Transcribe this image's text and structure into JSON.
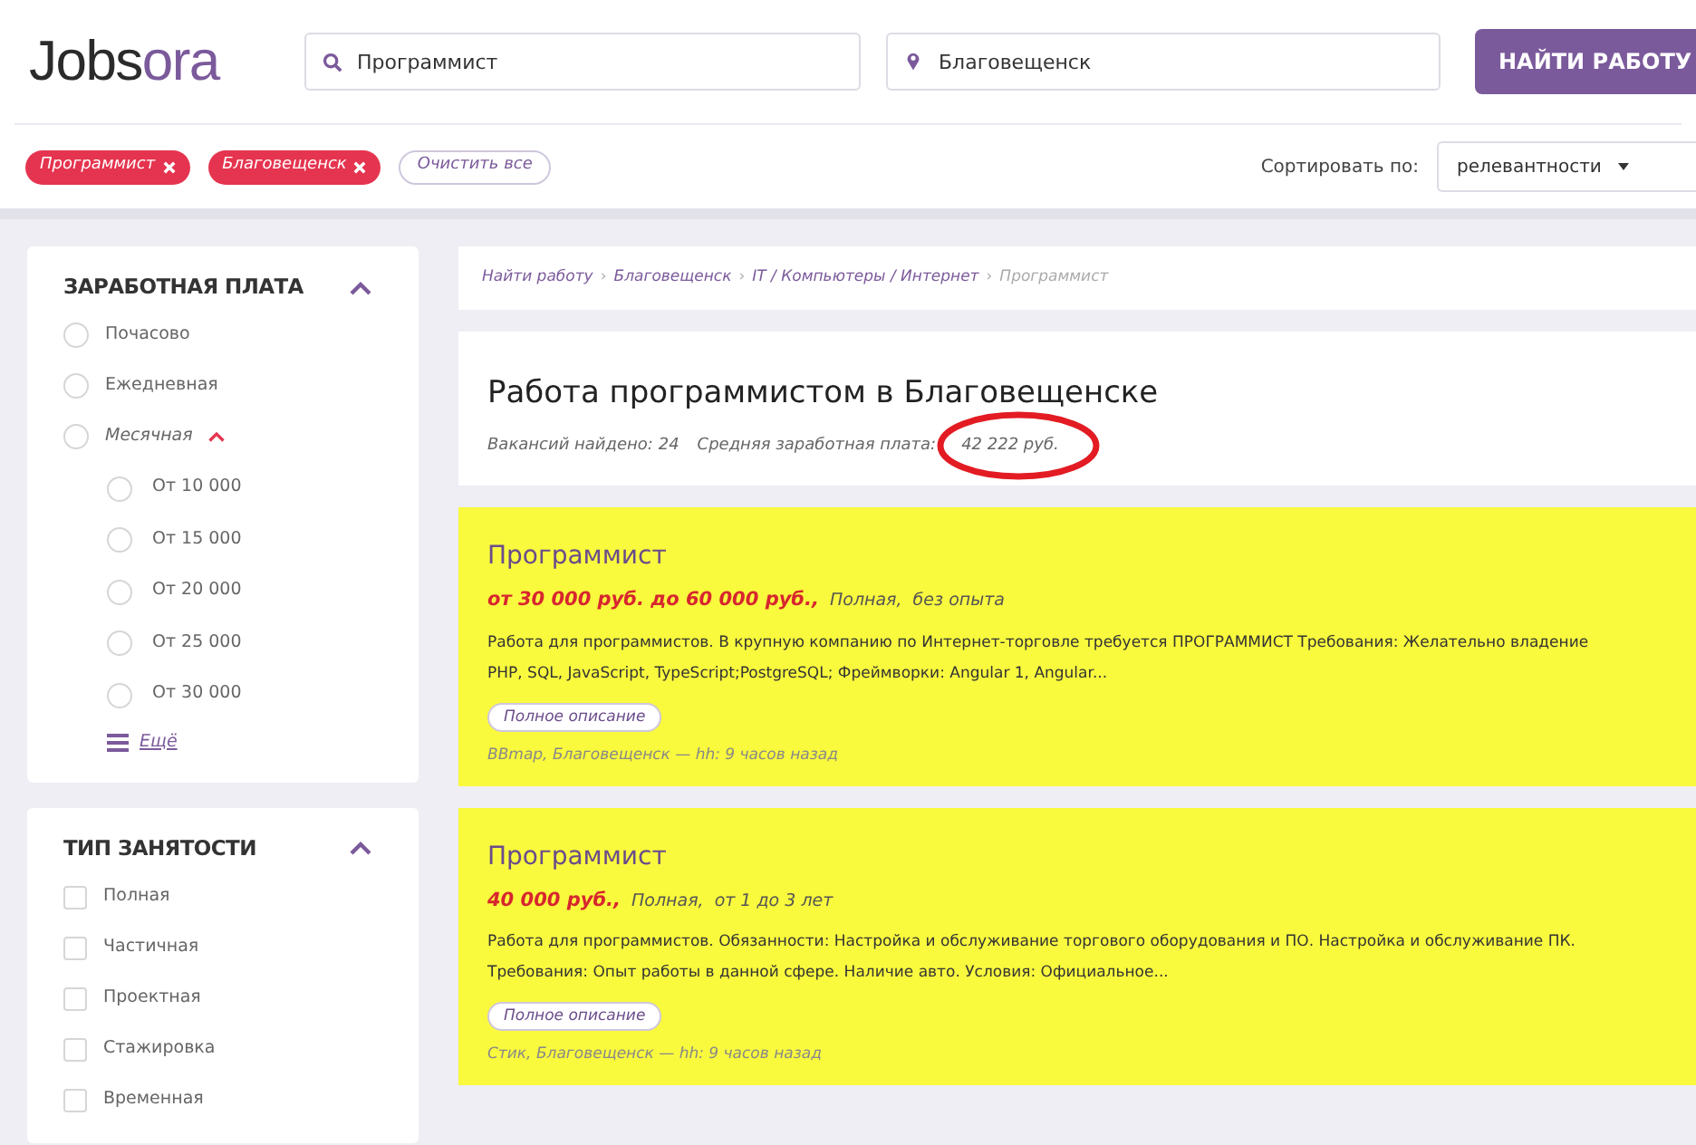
{
  "logo": {
    "part1": "Jobs",
    "part2": "ora"
  },
  "search": {
    "value": "Программист"
  },
  "location": {
    "value": "Благовещенск"
  },
  "find_button": "НАЙТИ РАБОТУ",
  "filter_tags": [
    {
      "label": "Программист"
    },
    {
      "label": "Благовещенск"
    }
  ],
  "clear_all": "Очистить все",
  "sort": {
    "label": "Сортировать по:",
    "value": "релевантности"
  },
  "filters": [
    {
      "title": "ЗАРАБОТНАЯ ПЛАТА",
      "expanded": true,
      "kind": "radio",
      "items": [
        {
          "label": "Почасово",
          "checked": false
        },
        {
          "label": "Ежедневная",
          "checked": false
        },
        {
          "label": "Месячная",
          "checked": false,
          "expanded": true,
          "children": [
            {
              "label": "От 10 000",
              "checked": false
            },
            {
              "label": "От 15 000",
              "checked": false
            },
            {
              "label": "От 20 000",
              "checked": false
            },
            {
              "label": "От 25 000",
              "checked": false
            },
            {
              "label": "От 30 000",
              "checked": false
            }
          ]
        }
      ],
      "more": "Ещё"
    },
    {
      "title": "ТИП ЗАНЯТОСТИ",
      "expanded": true,
      "kind": "checkbox",
      "items": [
        {
          "label": "Полная",
          "checked": false
        },
        {
          "label": "Частичная",
          "checked": false
        },
        {
          "label": "Проектная",
          "checked": false
        },
        {
          "label": "Стажировка",
          "checked": false
        },
        {
          "label": "Временная",
          "checked": false
        }
      ]
    }
  ],
  "breadcrumb": [
    {
      "label": "Найти работу"
    },
    {
      "separator": "›",
      "label": "Благовещенск"
    },
    {
      "separator": "›",
      "label": "IT / Компьютеры / Интернет"
    },
    {
      "separator": "›",
      "label": "Программист"
    }
  ],
  "heading": "Работа программистом в Благовещенске",
  "stats": {
    "found_label": "Вакансий найдено:",
    "found": "24",
    "avg_label": "Средняя заработная плата:",
    "avg": "42 222 руб."
  },
  "jobs": [
    {
      "title": "Программист",
      "highlighted": true,
      "salary": "от 30 000 руб. до 60 000 руб.,",
      "employment": "Полная,",
      "experience": "без опыта",
      "description": "Работа для программистов. В крупную компанию по Интернет-торговле требуется ПРОГРАММИСТ Требования: Желательно владение PHP, SQL, JavaScript, TypeScript;PostgreSQL; Фреймворки: Angular 1, Angular...",
      "more": "Полное описание",
      "source": "BBmap, Благовещенск — hh: 9 часов назад"
    },
    {
      "title": "Программист",
      "highlighted": true,
      "salary": "40 000 руб.,",
      "employment": "Полная,",
      "experience": "от 1 до 3 лет",
      "description": "Работа для программистов. Обязанности: Настройка и обслуживание торгового оборудования и ПО. Настройка и обслуживание ПК. Требования: Опыт работы в данной сфере. Наличие авто. Условия: Официальное...",
      "more": "Полное описание",
      "source": "Стик, Благовещенск — hh: 9 часов назад"
    }
  ]
}
